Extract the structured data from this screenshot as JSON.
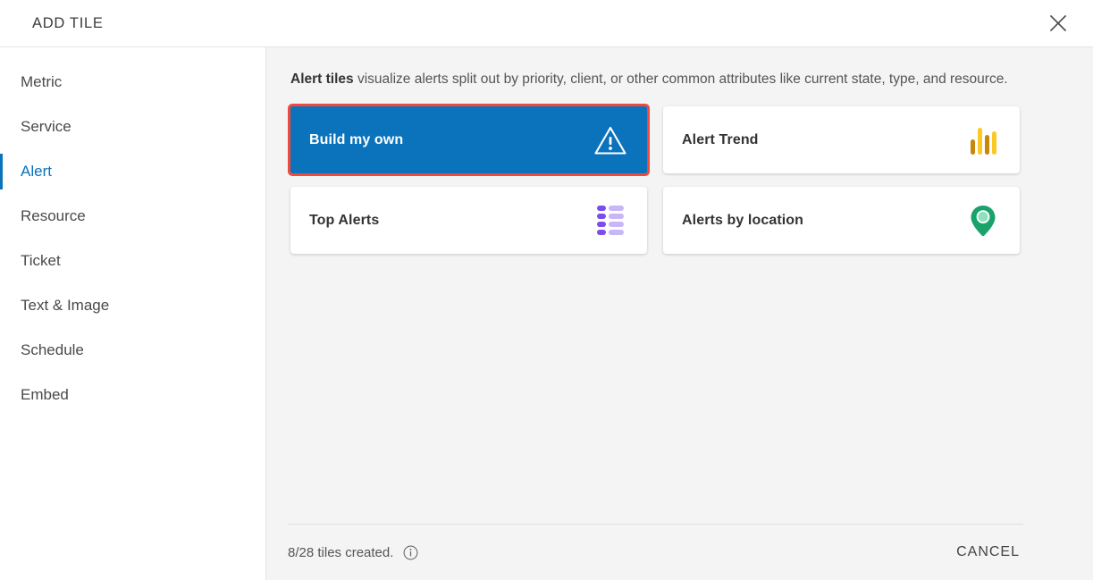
{
  "header": {
    "title": "ADD TILE",
    "close_icon": "close-icon"
  },
  "sidebar": {
    "items": [
      {
        "label": "Metric",
        "active": false
      },
      {
        "label": "Service",
        "active": false
      },
      {
        "label": "Alert",
        "active": true
      },
      {
        "label": "Resource",
        "active": false
      },
      {
        "label": "Ticket",
        "active": false
      },
      {
        "label": "Text & Image",
        "active": false
      },
      {
        "label": "Schedule",
        "active": false
      },
      {
        "label": "Embed",
        "active": false
      }
    ]
  },
  "main": {
    "description_bold": "Alert tiles",
    "description_rest": " visualize alerts split out by priority, client, or other common attributes like current state, type, and resource.",
    "tiles": [
      {
        "label": "Build my own",
        "icon": "warning-triangle-icon",
        "selected": true,
        "highlighted": true
      },
      {
        "label": "Alert Trend",
        "icon": "bar-chart-icon",
        "selected": false,
        "highlighted": false
      },
      {
        "label": "Top Alerts",
        "icon": "list-icon",
        "selected": false,
        "highlighted": false
      },
      {
        "label": "Alerts by location",
        "icon": "location-pin-icon",
        "selected": false,
        "highlighted": false
      }
    ]
  },
  "footer": {
    "tiles_created": "8/28 tiles created.",
    "info_icon": "info-icon",
    "cancel_label": "CANCEL"
  },
  "colors": {
    "accent_blue": "#0a73bb",
    "highlight_red": "#f04a3f",
    "bar_dark": "#c8860d",
    "bar_light": "#fcc824",
    "list_dark": "#7c4dec",
    "list_light": "#c8b6f7",
    "pin_green": "#19a36a",
    "pin_inner": "#8fe0bd",
    "panel_bg": "#f4f4f4"
  }
}
